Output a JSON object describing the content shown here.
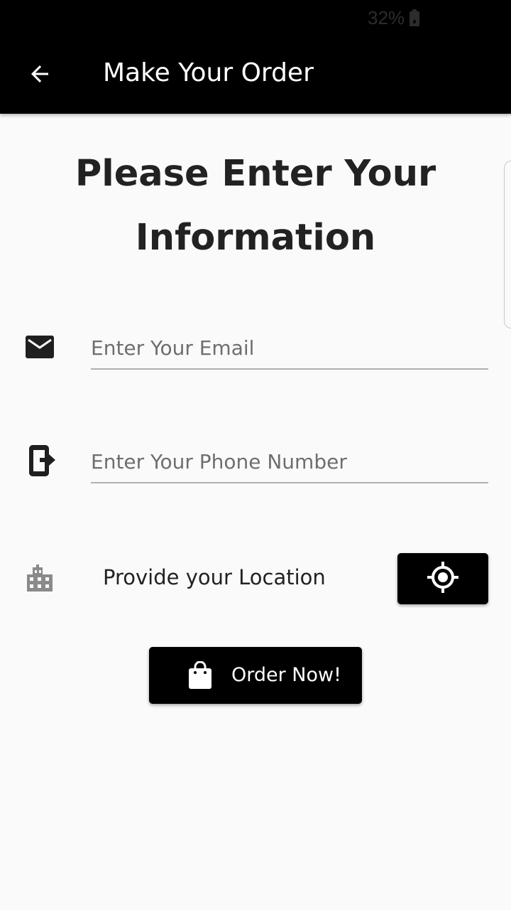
{
  "status_bar": {
    "battery": "32%",
    "battery_icon": "battery-icon"
  },
  "app_bar": {
    "back_icon": "arrow-left-icon",
    "title": "Make Your Order"
  },
  "heading": {
    "line1": "Please Enter Your",
    "line2": "Information"
  },
  "form": {
    "email": {
      "icon": "email-icon",
      "placeholder": "Enter Your Email",
      "value": ""
    },
    "phone": {
      "icon": "phone-icon",
      "placeholder": "Enter Your Phone Number",
      "value": ""
    },
    "location": {
      "icon": "city-icon",
      "label": "Provide your Location",
      "button_icon": "gps-target-icon"
    }
  },
  "order_button": {
    "icon": "shopping-bag-icon",
    "label": "Order Now!"
  },
  "colors": {
    "app_bar": "#000000",
    "background": "#fafafa",
    "button": "#000000",
    "underline": "#b0b0b0"
  }
}
